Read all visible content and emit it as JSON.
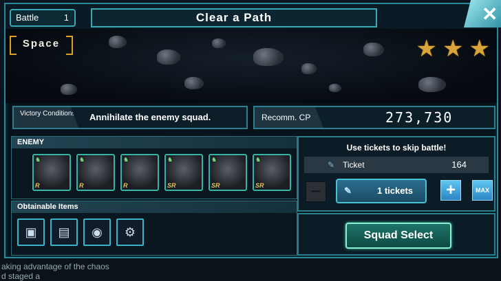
{
  "header": {
    "battle_label": "Battle",
    "battle_number": "1",
    "title": "Clear a Path"
  },
  "stage": {
    "location": "Space",
    "stars": 3,
    "star_color": "#d9a43a"
  },
  "victory": {
    "label": "Victory Conditions",
    "value": "Annihilate the enemy squad."
  },
  "recommended_cp": {
    "label": "Recomm. CP",
    "value": "273,730"
  },
  "enemy": {
    "label": "ENEMY",
    "units": [
      {
        "rank": "R",
        "icon": "mech-unit-icon"
      },
      {
        "rank": "R",
        "icon": "mech-unit-icon"
      },
      {
        "rank": "R",
        "icon": "mech-unit-icon"
      },
      {
        "rank": "SR",
        "icon": "mech-unit-icon"
      },
      {
        "rank": "SR",
        "icon": "mech-unit-icon"
      },
      {
        "rank": "SR",
        "icon": "mech-unit-icon"
      }
    ]
  },
  "items": {
    "label": "Obtainable Items",
    "list": [
      {
        "icon": "chip-icon"
      },
      {
        "icon": "manual-icon"
      },
      {
        "icon": "ur-coin-icon"
      },
      {
        "icon": "part-icon"
      }
    ]
  },
  "skip": {
    "title": "Use tickets to skip battle!",
    "ticket_label": "Ticket",
    "ticket_count": "164",
    "minus_label": "−",
    "selected_label": "1 tickets",
    "plus_label": "+",
    "max_label": "MAX"
  },
  "squad_button": "Squad Select",
  "close_label": "✕",
  "background_text": {
    "line1": "aking advantage of the chaos",
    "line2": "d staged a"
  }
}
